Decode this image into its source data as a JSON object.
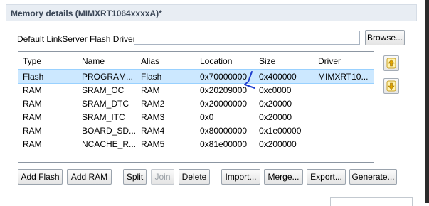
{
  "section": {
    "title": "Memory details (MIMXRT1064xxxxA)*"
  },
  "driver": {
    "label": "Default LinkServer Flash Driver",
    "value": "",
    "browse_label": "Browse..."
  },
  "table": {
    "headers": {
      "type": "Type",
      "name": "Name",
      "alias": "Alias",
      "location": "Location",
      "size": "Size",
      "driver": "Driver"
    },
    "rows": [
      {
        "type": "Flash",
        "name": "PROGRAM...",
        "alias": "Flash",
        "location": "0x70000000",
        "size": "0x400000",
        "driver": "MIMXRT10..."
      },
      {
        "type": "RAM",
        "name": "SRAM_OC",
        "alias": "RAM",
        "location": "0x20209000",
        "size": "0xc0000",
        "driver": ""
      },
      {
        "type": "RAM",
        "name": "SRAM_DTC",
        "alias": "RAM2",
        "location": "0x20000000",
        "size": "0x20000",
        "driver": ""
      },
      {
        "type": "RAM",
        "name": "SRAM_ITC",
        "alias": "RAM3",
        "location": "0x0",
        "size": "0x20000",
        "driver": ""
      },
      {
        "type": "RAM",
        "name": "BOARD_SD...",
        "alias": "RAM4",
        "location": "0x80000000",
        "size": "0x1e00000",
        "driver": ""
      },
      {
        "type": "RAM",
        "name": "NCACHE_R...",
        "alias": "RAM5",
        "location": "0x81e00000",
        "size": "0x200000",
        "driver": ""
      }
    ]
  },
  "side_buttons": {
    "up_icon": "move-up-icon",
    "down_icon": "move-down-icon"
  },
  "actions": {
    "add_flash": "Add Flash",
    "add_ram": "Add RAM",
    "split": "Split",
    "join": "Join",
    "delete": "Delete",
    "import": "Import...",
    "merge": "Merge...",
    "export": "Export...",
    "generate": "Generate..."
  },
  "colors": {
    "selection": "#cce8ff",
    "header_bg": "#e8edf3",
    "annotation": "#1f3fcf"
  }
}
